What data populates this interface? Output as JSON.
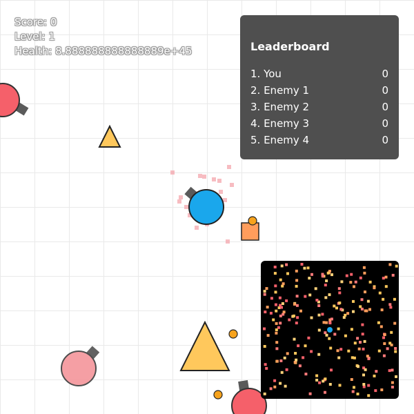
{
  "hud": {
    "score": "Score: 0",
    "level": "Level: 1",
    "health": "Health: 8.888888888888889e+45"
  },
  "leaderboard": {
    "title": "Leaderboard",
    "entries": [
      {
        "name": "1. You",
        "score": "0"
      },
      {
        "name": "2. Enemy 1",
        "score": "0"
      },
      {
        "name": "3. Enemy 2",
        "score": "0"
      },
      {
        "name": "4. Enemy 3",
        "score": "0"
      },
      {
        "name": "5. Enemy 4",
        "score": "0"
      }
    ]
  },
  "colors": {
    "player": "#1aa7ec",
    "enemy": "#f5606a",
    "enemy_faded": "#f59aa0",
    "barrel": "#5a5a5a",
    "triangle": "#ffc85c",
    "square": "#ff9d5c",
    "pellet": "#f7a31d",
    "particle": "#f4a0a6",
    "minimap_bg": "#000000",
    "grid": "#e9e9e9"
  },
  "icons": {
    "player": "blue-tank-icon",
    "enemy": "red-tank-icon",
    "triangle": "triangle-shape-icon",
    "square": "square-shape-icon",
    "pellet": "pellet-icon"
  }
}
